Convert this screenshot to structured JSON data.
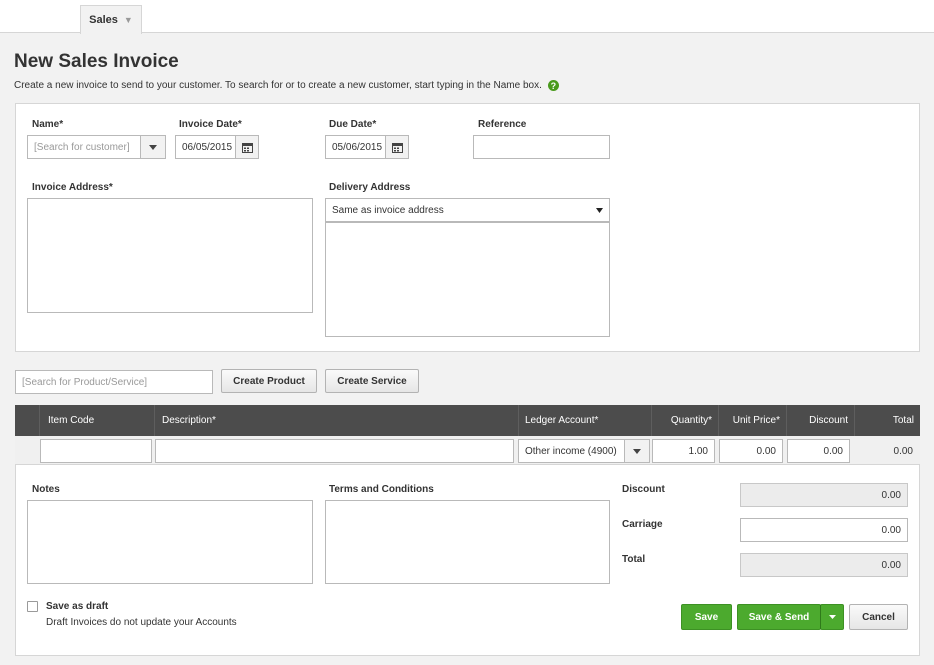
{
  "nav": {
    "tab_label": "Sales",
    "tab_caret": "▼"
  },
  "header": {
    "title": "New Sales Invoice",
    "description": "Create a new invoice to send to your customer. To search for or to create a new customer, start typing in the Name box.",
    "help_icon": "?"
  },
  "form": {
    "name_label": "Name*",
    "name_placeholder": "[Search for customer]",
    "invoice_date_label": "Invoice Date*",
    "invoice_date_value": "06/05/2015",
    "due_date_label": "Due Date*",
    "due_date_value": "05/06/2015",
    "reference_label": "Reference",
    "reference_value": "",
    "invoice_address_label": "Invoice Address*",
    "delivery_address_label": "Delivery Address",
    "delivery_address_option": "Same as invoice address"
  },
  "products": {
    "search_placeholder": "[Search for Product/Service]",
    "create_product_label": "Create Product",
    "create_service_label": "Create Service"
  },
  "grid": {
    "columns": [
      "Item Code",
      "Description*",
      "Ledger Account*",
      "Quantity*",
      "Unit Price*",
      "Discount",
      "Total"
    ],
    "row": {
      "item_code": "",
      "description": "",
      "ledger_account": "Other income (4900)",
      "quantity": "1.00",
      "unit_price": "0.00",
      "discount": "0.00",
      "total": "0.00"
    }
  },
  "footer": {
    "notes_label": "Notes",
    "terms_label": "Terms and Conditions",
    "discount_label": "Discount",
    "discount_value": "0.00",
    "carriage_label": "Carriage",
    "carriage_value": "0.00",
    "total_label": "Total",
    "total_value": "0.00",
    "save_draft_label": "Save as draft",
    "save_draft_note": "Draft Invoices do not update your Accounts",
    "save_label": "Save",
    "save_send_label": "Save & Send",
    "cancel_label": "Cancel"
  },
  "colors": {
    "accent_green": "#4caa2e",
    "grid_header": "#4c4c4c"
  }
}
